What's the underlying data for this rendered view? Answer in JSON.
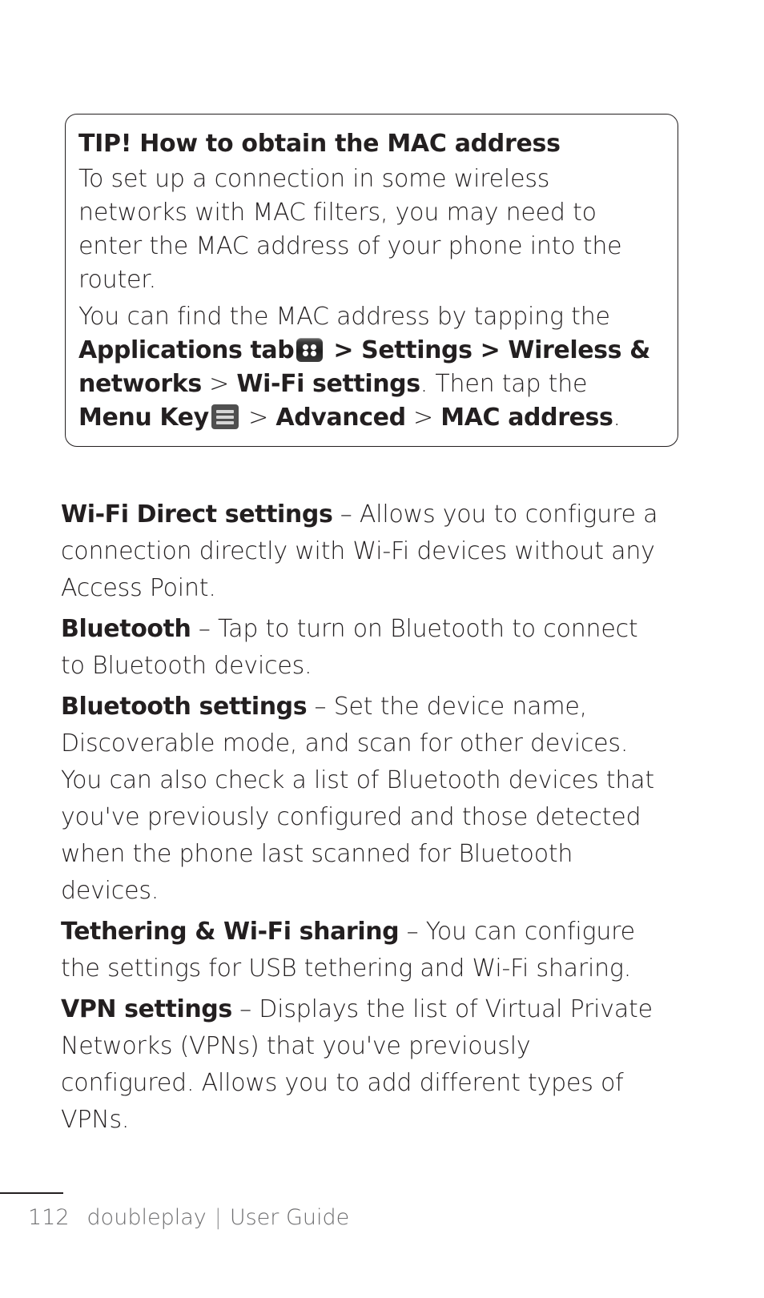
{
  "tip_box": {
    "title": "TIP! How to obtain the MAC address",
    "paragraph_1": "To set up a connection in some wireless networks with MAC filters, you may need to enter the MAC address of your phone into the router.",
    "paragraph_2_part1": "You can find the MAC address by tapping the ",
    "applications_tab_label": "Applications tab",
    "apps_icon_name": "applications-tab-icon",
    "after_apps_icon": " > ",
    "settings_label": "Settings",
    "sep_1": " > ",
    "wireless_networks_label": "Wireless & networks",
    "sep_2": " > ",
    "wifi_settings_label": "Wi-Fi settings",
    "then_text": ". Then tap the ",
    "menu_key_label": "Menu Key",
    "menu_icon_name": "menu-key-icon",
    "sep_3": " > ",
    "advanced_label": "Advanced",
    "sep_4": " > ",
    "mac_address_label": "MAC address",
    "end_period": "."
  },
  "sections": [
    {
      "term": "Wi-Fi Direct settings",
      "description": " – Allows you to configure a connection directly with Wi-Fi devices without any Access Point."
    },
    {
      "term": "Bluetooth",
      "description": " – Tap to turn on Bluetooth to connect to Bluetooth devices."
    },
    {
      "term": "Bluetooth settings",
      "description": " – Set the device name, Discoverable mode, and scan for other devices. You can also check a list of Bluetooth devices that you've previously configured and those detected when the phone last scanned for Bluetooth devices."
    },
    {
      "term": "Tethering & Wi-Fi sharing",
      "description": " – You can configure the settings for USB tethering and Wi-Fi sharing."
    },
    {
      "term": "VPN settings",
      "description": " – Displays the list of Virtual Private Networks (VPNs) that you've previously configured. Allows you to add different types of VPNs."
    }
  ],
  "footer": {
    "page_number": "112",
    "product_name": "doubleplay",
    "separator": "|",
    "doc_type": "User Guide"
  },
  "colors": {
    "text": "#231f20",
    "footer_text": "#6e6e70",
    "box_border": "#231f20",
    "apps_icon_bg": "#1e1e1e",
    "menu_icon_bg": "#4f4f4f"
  }
}
